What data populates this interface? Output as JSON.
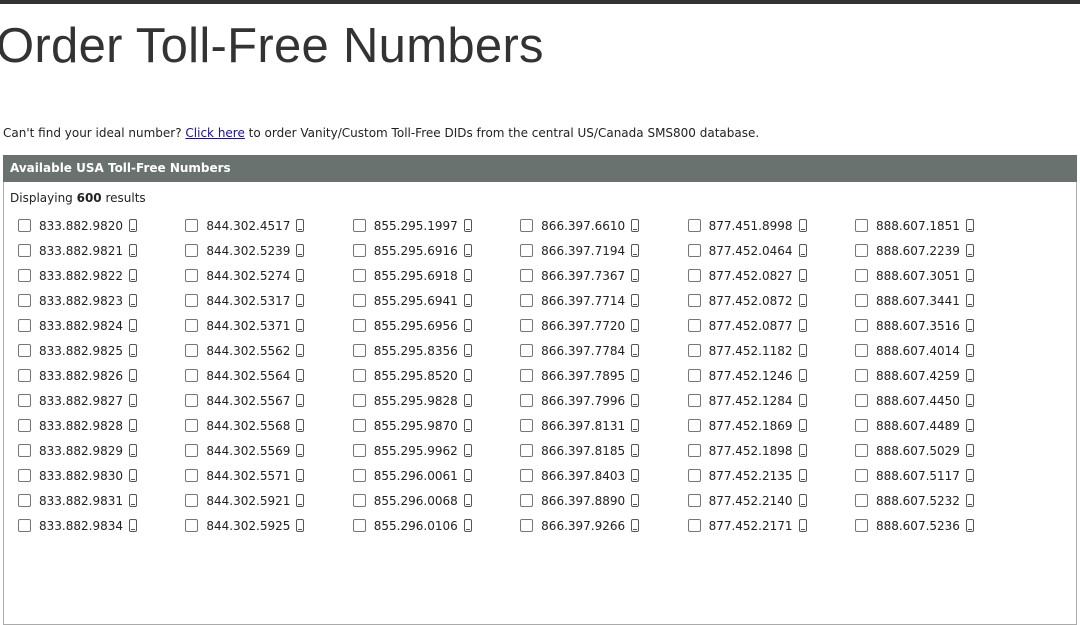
{
  "page": {
    "title": "Order Toll-Free Numbers",
    "intro_before": "Can't find your ideal number? ",
    "intro_link": "Click here",
    "intro_after": " to order Vanity/Custom Toll-Free DIDs from the central US/Canada SMS800 database."
  },
  "panel": {
    "header": "Available USA Toll-Free Numbers",
    "count_prefix": "Displaying ",
    "count": "600",
    "count_suffix": " results"
  },
  "icons": {
    "number_icon": "mobile-phone-icon"
  },
  "numbers": [
    [
      "833.882.9820",
      "844.302.4517",
      "855.295.1997",
      "866.397.6610",
      "877.451.8998",
      "888.607.1851"
    ],
    [
      "833.882.9821",
      "844.302.5239",
      "855.295.6916",
      "866.397.7194",
      "877.452.0464",
      "888.607.2239"
    ],
    [
      "833.882.9822",
      "844.302.5274",
      "855.295.6918",
      "866.397.7367",
      "877.452.0827",
      "888.607.3051"
    ],
    [
      "833.882.9823",
      "844.302.5317",
      "855.295.6941",
      "866.397.7714",
      "877.452.0872",
      "888.607.3441"
    ],
    [
      "833.882.9824",
      "844.302.5371",
      "855.295.6956",
      "866.397.7720",
      "877.452.0877",
      "888.607.3516"
    ],
    [
      "833.882.9825",
      "844.302.5562",
      "855.295.8356",
      "866.397.7784",
      "877.452.1182",
      "888.607.4014"
    ],
    [
      "833.882.9826",
      "844.302.5564",
      "855.295.8520",
      "866.397.7895",
      "877.452.1246",
      "888.607.4259"
    ],
    [
      "833.882.9827",
      "844.302.5567",
      "855.295.9828",
      "866.397.7996",
      "877.452.1284",
      "888.607.4450"
    ],
    [
      "833.882.9828",
      "844.302.5568",
      "855.295.9870",
      "866.397.8131",
      "877.452.1869",
      "888.607.4489"
    ],
    [
      "833.882.9829",
      "844.302.5569",
      "855.295.9962",
      "866.397.8185",
      "877.452.1898",
      "888.607.5029"
    ],
    [
      "833.882.9830",
      "844.302.5571",
      "855.296.0061",
      "866.397.8403",
      "877.452.2135",
      "888.607.5117"
    ],
    [
      "833.882.9831",
      "844.302.5921",
      "855.296.0068",
      "866.397.8890",
      "877.452.2140",
      "888.607.5232"
    ],
    [
      "833.882.9834",
      "844.302.5925",
      "855.296.0106",
      "866.397.9266",
      "877.452.2171",
      "888.607.5236"
    ]
  ]
}
